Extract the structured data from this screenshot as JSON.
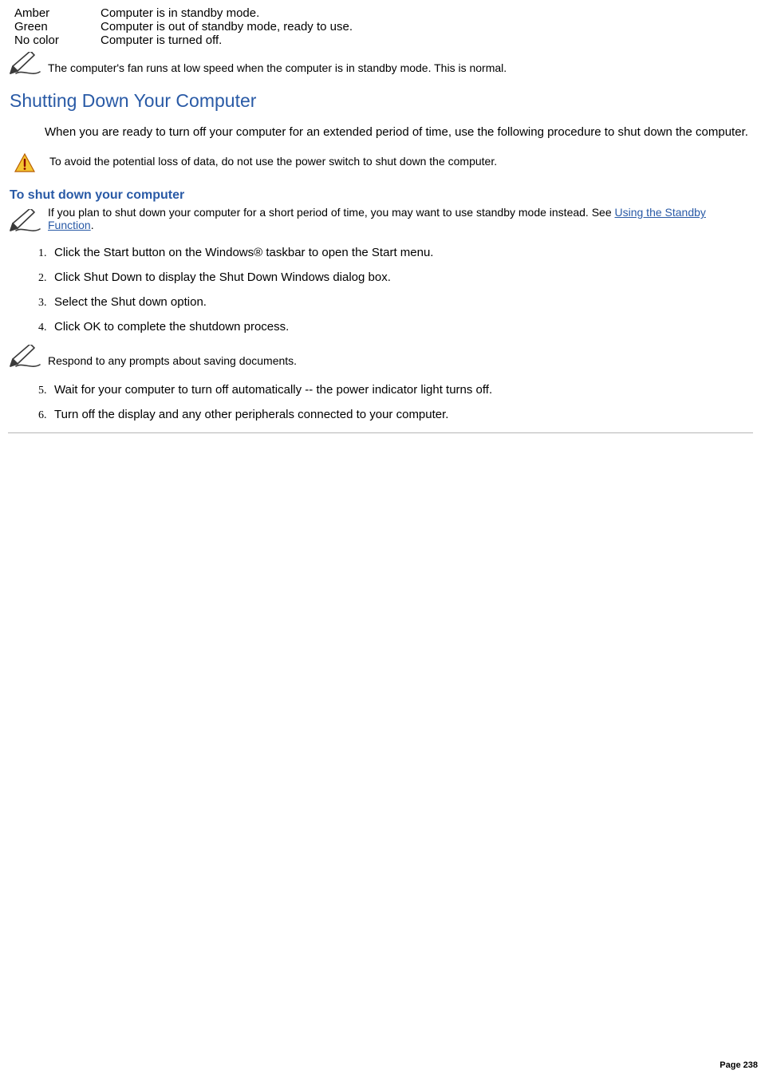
{
  "status": [
    {
      "label": "Amber",
      "desc": "Computer is in standby mode."
    },
    {
      "label": "Green",
      "desc": "Computer is out of standby mode, ready to use."
    },
    {
      "label": "No color",
      "desc": "Computer is turned off."
    }
  ],
  "note_fan": "The computer's fan runs at low speed when the computer is in standby mode. This is normal.",
  "heading_shutdown": "Shutting Down Your Computer",
  "para_shutdown": "When you are ready to turn off your computer for an extended period of time, use the following procedure to shut down the computer.",
  "warning_text": "To avoid the potential loss of data, do not use the power switch to shut down the computer.",
  "subheading": "To shut down your computer",
  "note_standby_prefix": "If you plan to shut down your computer for a short period of time, you may want to use standby mode instead. See ",
  "note_standby_link": "Using the Standby Function",
  "note_standby_suffix": ".",
  "steps_a": [
    "Click the Start button on the Windows® taskbar to open the Start menu.",
    "Click Shut Down to display the Shut Down Windows dialog box.",
    "Select the Shut down option.",
    "Click OK to complete the shutdown process."
  ],
  "mid_note": "Respond to any prompts about saving documents.",
  "steps_b": [
    "Wait for your computer to turn off automatically -- the power indicator light turns off.",
    "Turn off the display and any other peripherals connected to your computer."
  ],
  "page_number": "Page 238"
}
